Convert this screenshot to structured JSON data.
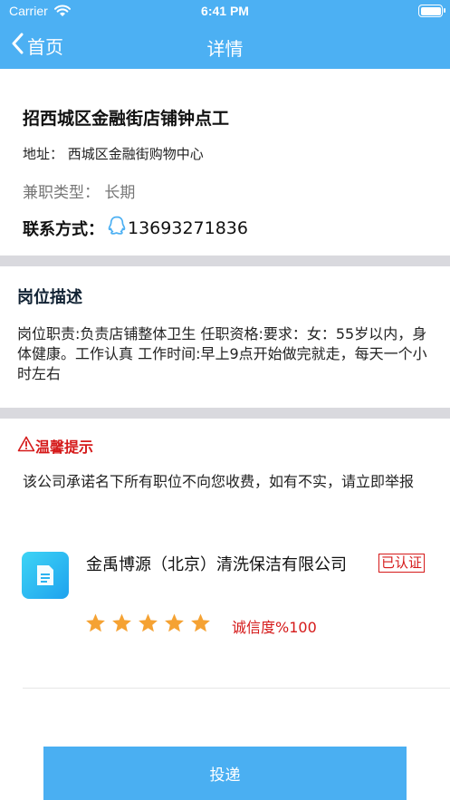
{
  "status_bar": {
    "carrier": "Carrier",
    "time": "6:41 PM"
  },
  "nav": {
    "back_label": "首页",
    "title": "详情"
  },
  "job": {
    "title": "招西城区金融街店铺钟点工",
    "address": "地址：  西城区金融街购物中心",
    "type": "兼职类型：  长期",
    "contact_label": "联系方式：",
    "phone": "13693271836"
  },
  "description": {
    "title": "岗位描述",
    "text": "岗位职责:负责店铺整体卫生 任职资格:要求：女：55岁以内，身体健康。工作认真 工作时间:早上9点开始做完就走，每天一个小时左右"
  },
  "tip": {
    "title": "温馨提示",
    "text": "该公司承诺名下所有职位不向您收费，如有不实，请立即举报"
  },
  "company": {
    "name": "金禹博源（北京）清洗保洁有限公司",
    "verified_label": "已认证",
    "rating": 5,
    "credit": "诚信度%100"
  },
  "actions": {
    "submit_label": "投递"
  },
  "colors": {
    "brand_blue": "#4cb0f3",
    "alert_red": "#d51a1a",
    "star_orange": "#f5a233"
  }
}
